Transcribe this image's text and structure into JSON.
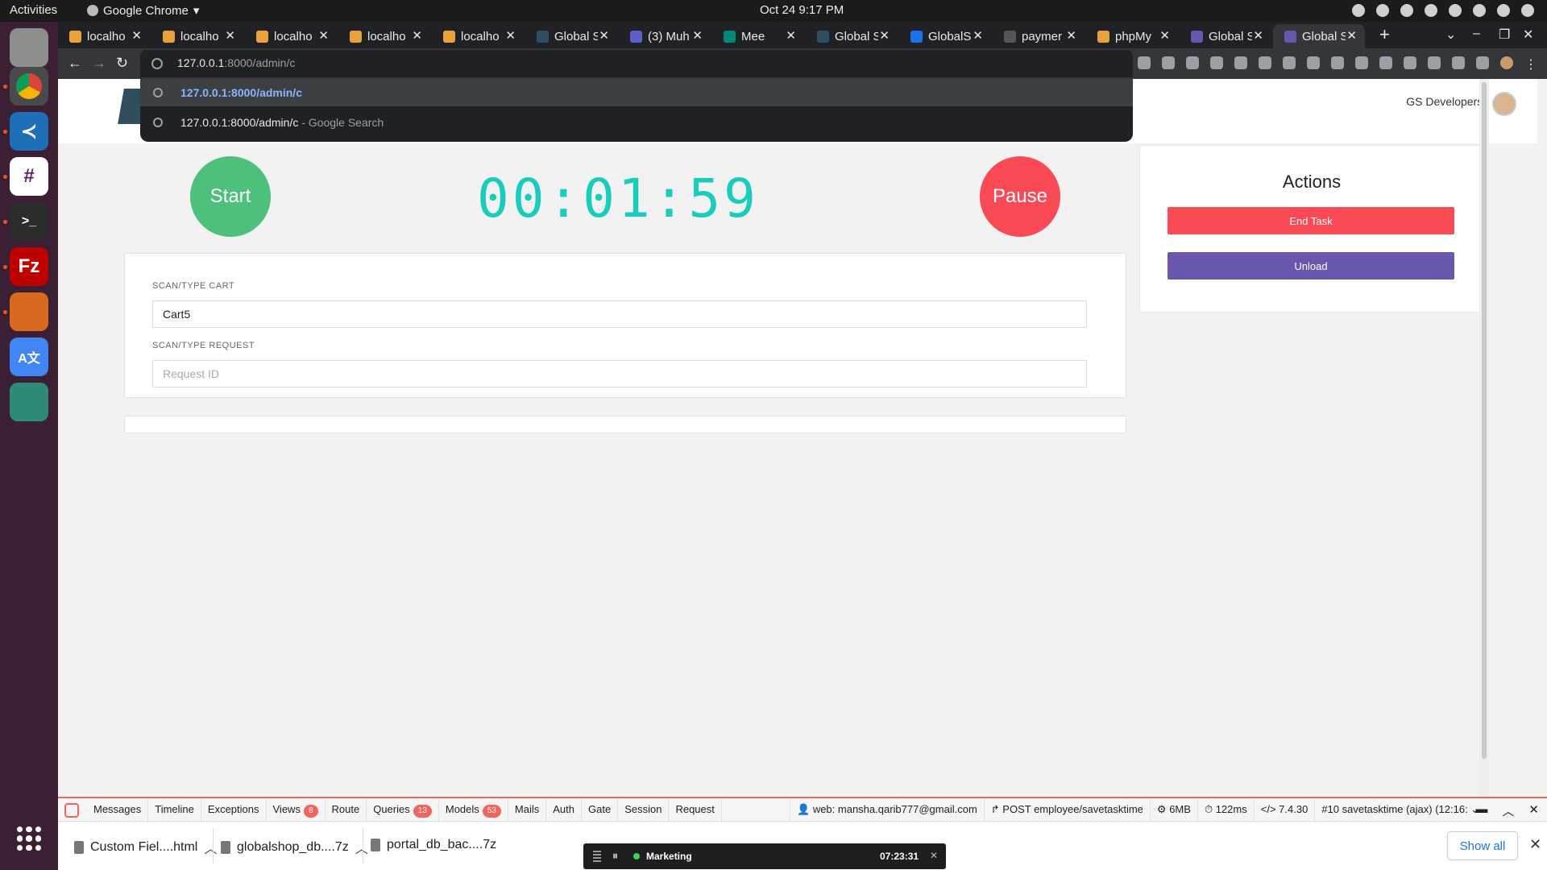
{
  "topbar": {
    "activities": "Activities",
    "app_name": "Google Chrome",
    "clock": "Oct 24   9:17 PM"
  },
  "tabs": [
    {
      "title": "localho",
      "color": "#e9a23b"
    },
    {
      "title": "localho",
      "color": "#e9a23b"
    },
    {
      "title": "localho",
      "color": "#e9a23b"
    },
    {
      "title": "localho",
      "color": "#e9a23b"
    },
    {
      "title": "localho",
      "color": "#e9a23b"
    },
    {
      "title": "Global S",
      "color": "#2f4f5f"
    },
    {
      "title": "(3) Muh",
      "color": "#5b5fc7"
    },
    {
      "title": "Mee",
      "color": "#00897b"
    },
    {
      "title": "Global S",
      "color": "#2f4f5f"
    },
    {
      "title": "GlobalS",
      "color": "#1a73e8"
    },
    {
      "title": "paymer",
      "color": "#555555"
    },
    {
      "title": "phpMy",
      "color": "#e9a23b"
    },
    {
      "title": "Global S",
      "color": "#6b56ad"
    },
    {
      "title": "Global S",
      "color": "#6b56ad"
    }
  ],
  "address_bar": {
    "typed_host": "127.0.0.1",
    "typed_rest": ":8000/admin/c"
  },
  "suggestions": [
    {
      "text": "127.0.0.1:8000/admin/c",
      "suffix": ""
    },
    {
      "text": "127.0.0.1:8000/admin/c",
      "suffix": " - Google Search"
    }
  ],
  "header": {
    "user_name": "GS Developers !"
  },
  "controls": {
    "start_label": "Start",
    "pause_label": "Pause",
    "timer": "00:01:59"
  },
  "form": {
    "cart_label": "SCAN/TYPE CART",
    "cart_value": "Cart5",
    "request_label": "SCAN/TYPE REQUEST",
    "request_placeholder": "Request ID"
  },
  "actions": {
    "title": "Actions",
    "end_task": "End Task",
    "unload": "Unload"
  },
  "debugbar": {
    "tabs": [
      {
        "label": "Messages",
        "badge": ""
      },
      {
        "label": "Timeline",
        "badge": ""
      },
      {
        "label": "Exceptions",
        "badge": ""
      },
      {
        "label": "Views",
        "badge": "8"
      },
      {
        "label": "Route",
        "badge": ""
      },
      {
        "label": "Queries",
        "badge": "13"
      },
      {
        "label": "Models",
        "badge": "53"
      },
      {
        "label": "Mails",
        "badge": ""
      },
      {
        "label": "Auth",
        "badge": ""
      },
      {
        "label": "Gate",
        "badge": ""
      },
      {
        "label": "Session",
        "badge": ""
      },
      {
        "label": "Request",
        "badge": ""
      }
    ],
    "user": "web: mansha.qarib777@gmail.com",
    "route": "POST employee/savetasktime",
    "memory": "6MB",
    "time": "122ms",
    "php": "7.4.30",
    "request": "#10 savetasktime (ajax) (12:16:"
  },
  "downloads": {
    "items": [
      "Custom Fiel....html",
      "globalshop_db....7z",
      "portal_db_bac....7z"
    ],
    "show_all": "Show all"
  },
  "mini_timer": {
    "name": "Marketing",
    "time": "07:23:31"
  }
}
